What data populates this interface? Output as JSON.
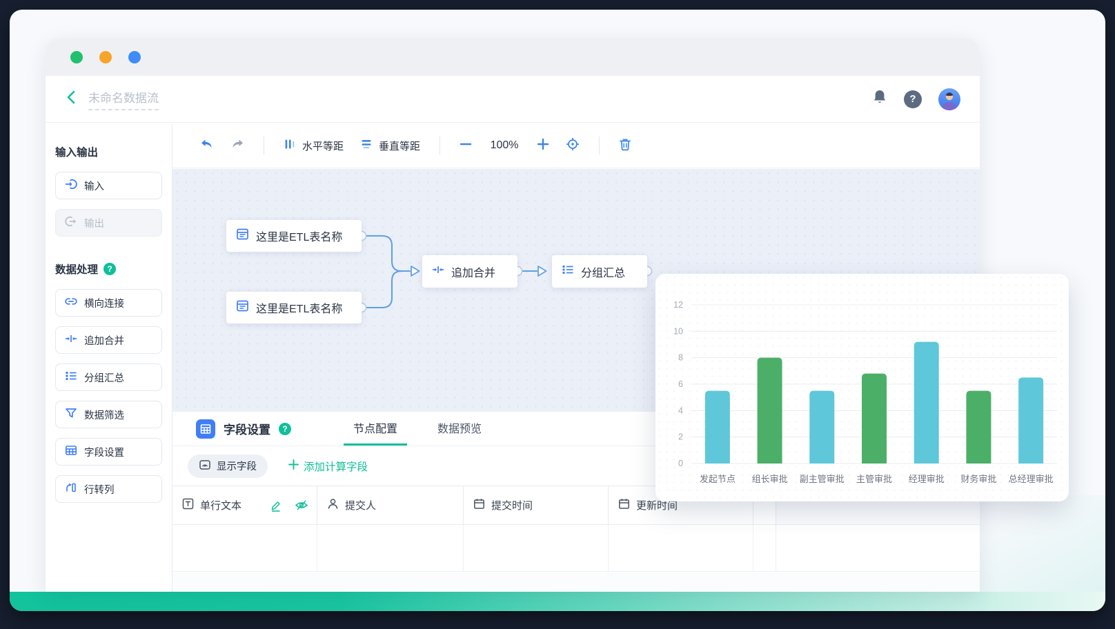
{
  "colors": {
    "accent_teal": "#10bf9b",
    "accent_blue": "#3f7ef7",
    "connector_blue": "#5f9fe8",
    "bar_cyan": "#5ec7d9",
    "bar_green": "#4caf68",
    "bottom_bar_gradient_left": "#12c39c",
    "bottom_bar_gradient_right": "#e9f8f3"
  },
  "glyphs": {
    "question": "?"
  },
  "titlebar": {
    "traffic_lights": [
      "#22c06e",
      "#f7a42a",
      "#3f8cf6"
    ]
  },
  "header": {
    "title_placeholder": "未命名数据流"
  },
  "sidebar": {
    "io_heading": "输入输出",
    "input_label": "输入",
    "output_label": "输出",
    "process_heading": "数据处理",
    "process_items": [
      {
        "icon": "link-icon",
        "label": "横向连接"
      },
      {
        "icon": "merge-icon",
        "label": "追加合并"
      },
      {
        "icon": "group-icon",
        "label": "分组汇总"
      },
      {
        "icon": "filter-icon",
        "label": "数据筛选"
      },
      {
        "icon": "fields-icon",
        "label": "字段设置"
      },
      {
        "icon": "pivot-icon",
        "label": "行转列"
      }
    ]
  },
  "toolbar": {
    "h_distribute": "水平等距",
    "v_distribute": "垂直等距",
    "zoom_level": "100%"
  },
  "flow": {
    "etl_node_1": "这里是ETL表名称",
    "etl_node_2": "这里是ETL表名称",
    "merge_node": "追加合并",
    "group_node": "分组汇总"
  },
  "bottom_panel": {
    "title": "字段设置",
    "tab_node_config": "节点配置",
    "tab_data_preview": "数据预览",
    "show_fields": "显示字段",
    "add_calc_field": "添加计算字段",
    "columns": [
      {
        "icon": "text-field-icon",
        "label": "单行文本"
      },
      {
        "icon": "user-icon",
        "label": "提交人"
      },
      {
        "icon": "calendar-icon",
        "label": "提交时间"
      },
      {
        "icon": "calendar-icon",
        "label": "更新时间"
      }
    ]
  },
  "chart_data": {
    "type": "bar",
    "title": "",
    "xlabel": "",
    "ylabel": "",
    "categories": [
      "发起节点",
      "组长审批",
      "副主管审批",
      "主管审批",
      "经理审批",
      "财务审批",
      "总经理审批"
    ],
    "values": [
      5.5,
      8,
      5.5,
      6.8,
      9.2,
      5.5,
      6.5
    ],
    "bar_colors": [
      "#5ec7d9",
      "#4caf68",
      "#5ec7d9",
      "#4caf68",
      "#5ec7d9",
      "#4caf68",
      "#5ec7d9"
    ],
    "ylim": [
      0,
      12
    ],
    "ytick_step": 2,
    "grid": true,
    "legend": false
  }
}
